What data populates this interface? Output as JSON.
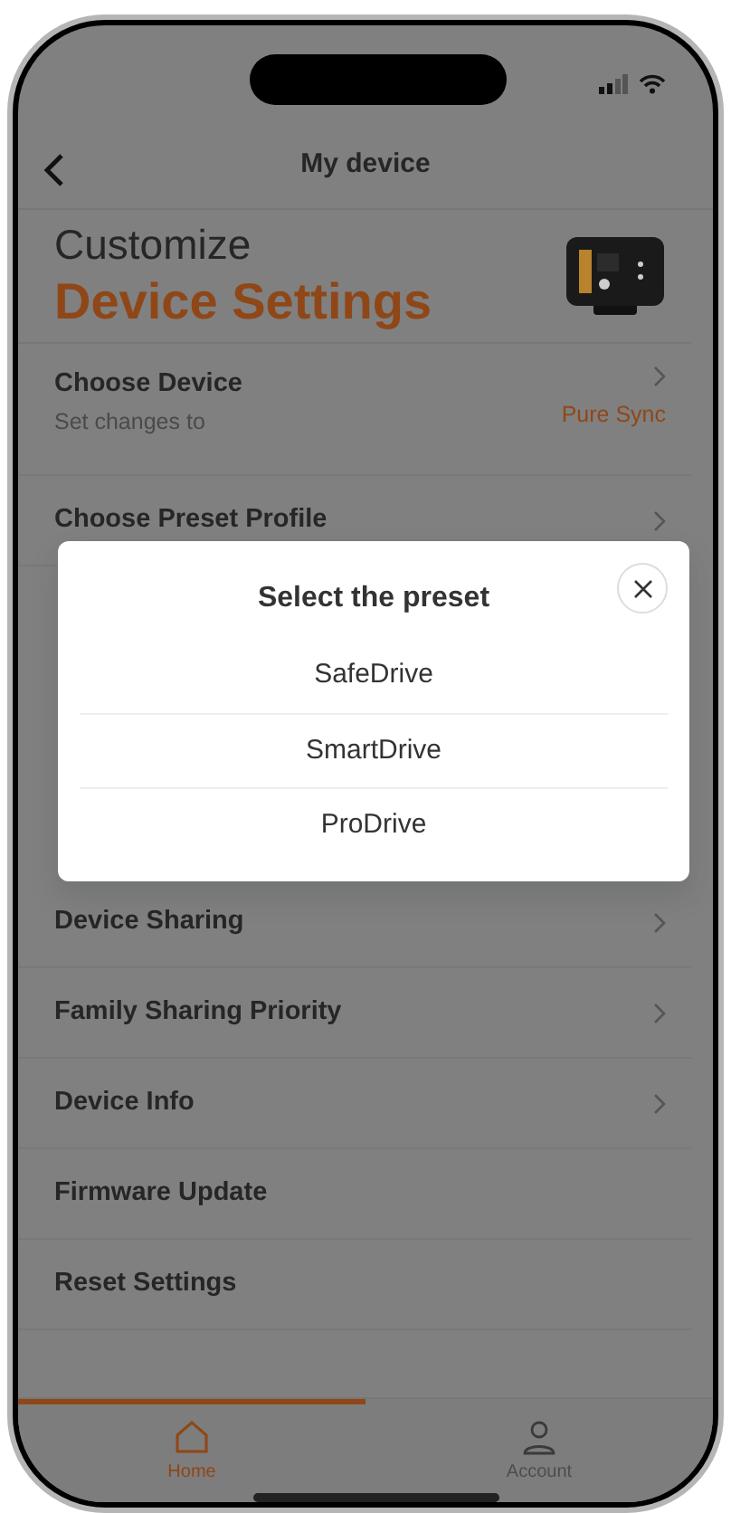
{
  "header": {
    "title": "My device"
  },
  "hero": {
    "line_1": "Customize",
    "line_2": "Device Settings"
  },
  "rows_above": [
    {
      "title": "Choose Device",
      "subtitle": "Set changes to",
      "value": "Pure Sync",
      "chevron": true
    },
    {
      "title": "Choose Preset Profile",
      "chevron": true
    }
  ],
  "modal": {
    "title": "Select the preset",
    "options": [
      "SafeDrive",
      "SmartDrive",
      "ProDrive"
    ]
  },
  "rows_below": [
    {
      "title": "Device Sharing",
      "chevron": true
    },
    {
      "title": "Family Sharing Priority",
      "chevron": true
    },
    {
      "title": "Device Info",
      "chevron": true
    },
    {
      "title": "Firmware Update",
      "chevron": false
    },
    {
      "title": "Reset Settings",
      "chevron": false
    }
  ],
  "tab_bar": [
    {
      "kind": "home",
      "label": "Home",
      "selected": true
    },
    {
      "kind": "account",
      "label": "Account",
      "selected": false
    }
  ]
}
